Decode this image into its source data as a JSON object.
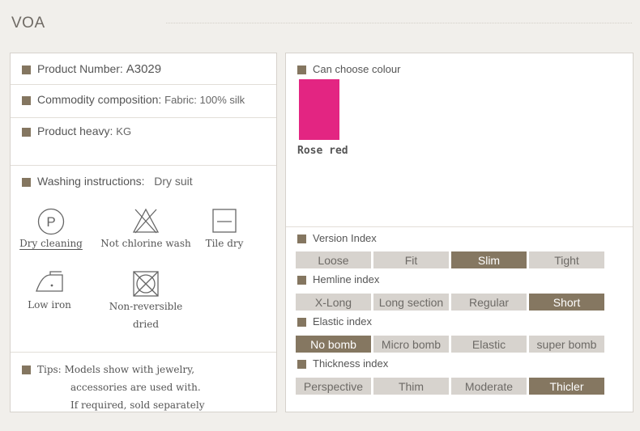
{
  "brand": "VOA",
  "product": {
    "number_label": "Product Number:",
    "number_value": "A3029",
    "composition_label": "Commodity composition:",
    "composition_value": "Fabric:  100%  silk",
    "heavy_label": "Product  heavy:",
    "heavy_value": "KG",
    "washing_label": "Washing instructions:",
    "washing_value": "Dry suit"
  },
  "care_icons": [
    {
      "label": "Dry cleaning",
      "icon": "dry-clean-p-icon"
    },
    {
      "label": "Not chlorine wash",
      "icon": "no-bleach-icon"
    },
    {
      "label": "Tile dry",
      "icon": "flat-dry-icon"
    },
    {
      "label": "Low iron",
      "icon": "low-iron-icon"
    },
    {
      "label": "Non-reversible",
      "label2": "dried",
      "icon": "no-tumble-dry-icon"
    }
  ],
  "tips": {
    "label": "Tips:",
    "line1": "Models show with jewelry,",
    "line2": "accessories are used with.",
    "line3": "If required, sold separately"
  },
  "colour": {
    "title": "Can choose colour",
    "swatch_color": "#e32582",
    "name": "Rose red"
  },
  "indexes": [
    {
      "title": "Version Index",
      "options": [
        "Loose",
        "Fit",
        "Slim",
        "Tight"
      ],
      "selected": 2
    },
    {
      "title": "Hemline index",
      "options": [
        "X-Long",
        "Long  section",
        "Regular",
        "Short"
      ],
      "selected": 3
    },
    {
      "title": "Elastic index",
      "options": [
        "No  bomb",
        "Micro  bomb",
        "Elastic",
        "super  bomb"
      ],
      "selected": 0
    },
    {
      "title": "Thickness index",
      "options": [
        "Perspective",
        "Thim",
        "Moderate",
        "Thicler"
      ],
      "selected": 3
    }
  ],
  "colors": {
    "accent": "#857761",
    "inactive": "#d7d3ce"
  }
}
